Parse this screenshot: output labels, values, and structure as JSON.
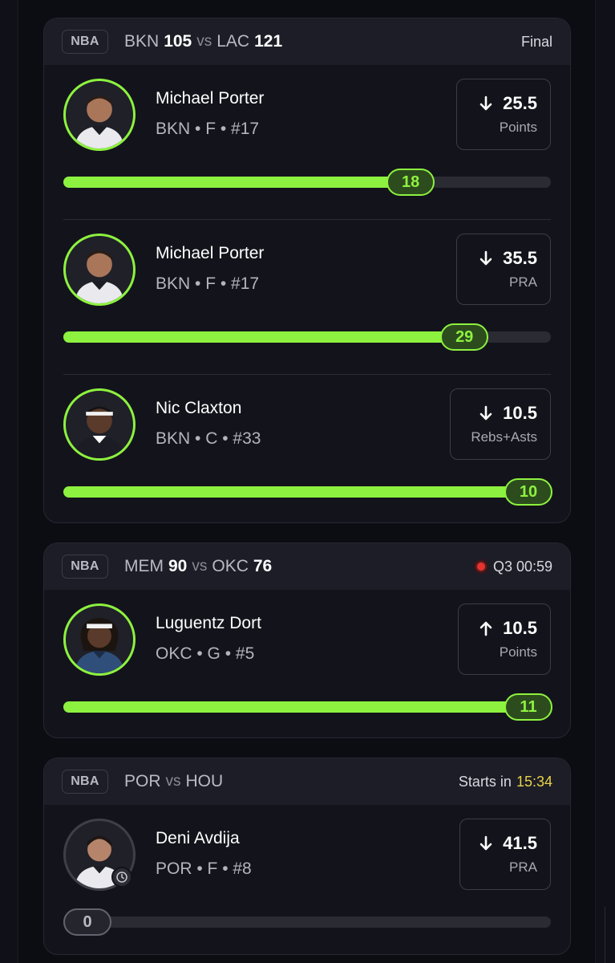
{
  "cards": [
    {
      "league": "NBA",
      "team_a": "BKN",
      "score_a": "105",
      "vs": "vs",
      "team_b": "LAC",
      "score_b": "121",
      "status": "Final",
      "players": [
        {
          "name": "Michael Porter",
          "info": "BKN • F • #17",
          "direction": "under",
          "line": "25.5",
          "stat_type": "Points",
          "current": "18",
          "progress": 0.71
        },
        {
          "name": "Michael Porter",
          "info": "BKN • F • #17",
          "direction": "under",
          "line": "35.5",
          "stat_type": "PRA",
          "current": "29",
          "progress": 0.82
        },
        {
          "name": "Nic Claxton",
          "info": "BKN • C • #33",
          "direction": "under",
          "line": "10.5",
          "stat_type": "Rebs+Asts",
          "current": "10",
          "progress": 1.0
        }
      ]
    },
    {
      "league": "NBA",
      "team_a": "MEM",
      "score_a": "90",
      "vs": "vs",
      "team_b": "OKC",
      "score_b": "76",
      "status": "Q3 00:59",
      "live": true,
      "players": [
        {
          "name": "Luguentz Dort",
          "info": "OKC • G • #5",
          "direction": "over",
          "line": "10.5",
          "stat_type": "Points",
          "current": "11",
          "progress": 1.0
        }
      ]
    },
    {
      "league": "NBA",
      "team_a": "POR",
      "vs": "vs",
      "team_b": "HOU",
      "status_prefix": "Starts in",
      "status_time": "15:34",
      "players": [
        {
          "name": "Deni Avdija",
          "info": "POR • F • #8",
          "direction": "under",
          "line": "41.5",
          "stat_type": "PRA",
          "current": "0",
          "progress": 0.0,
          "pending": true
        }
      ]
    }
  ],
  "colors": {
    "accent": "#8df23f",
    "live": "#e8322e",
    "countdown": "#e8d24a",
    "background": "#0c0d13",
    "card": "#13141b"
  },
  "icons": {
    "under": "arrow-down-icon",
    "over": "arrow-up-icon",
    "pending": "clock-icon",
    "live": "live-dot-icon"
  }
}
